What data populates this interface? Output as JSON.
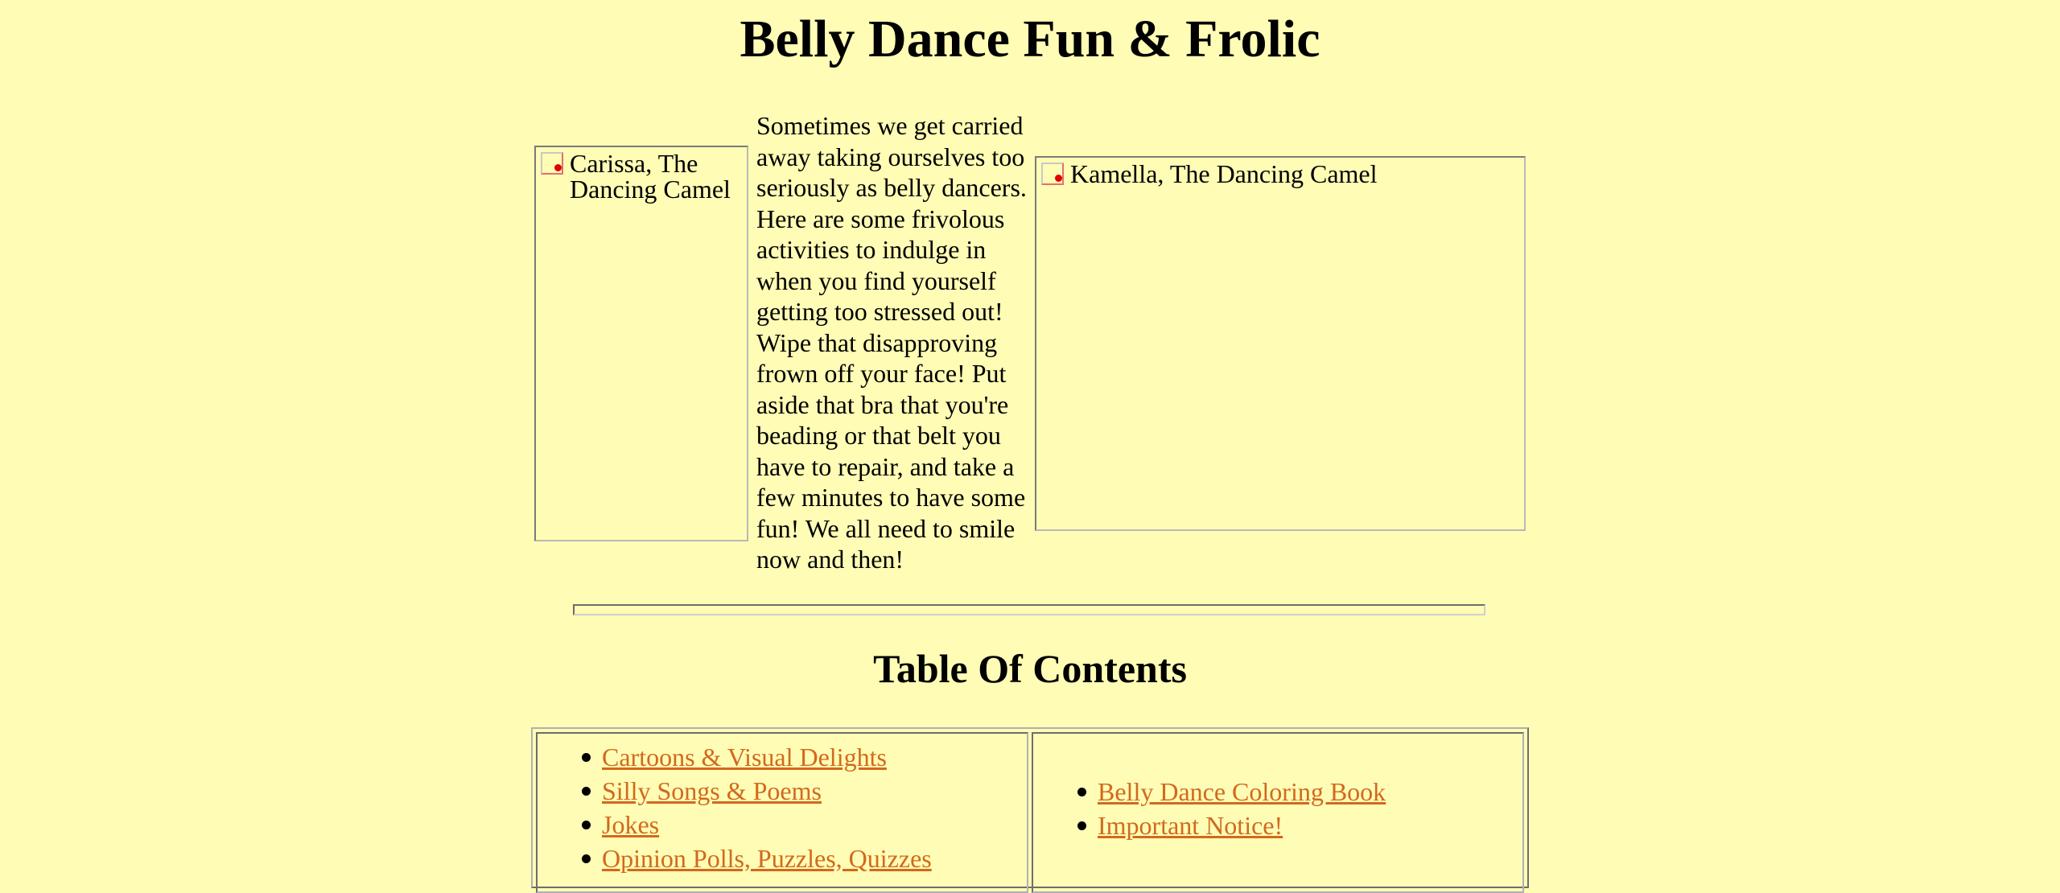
{
  "page": {
    "title": "Belly Dance Fun & Frolic"
  },
  "images": {
    "left": {
      "alt": "Carissa, The Dancing Camel",
      "icon": "broken-image-icon"
    },
    "right": {
      "alt": "Kamella, The Dancing Camel",
      "icon": "broken-image-icon"
    }
  },
  "intro": {
    "text": "Sometimes we get carried away taking ourselves too seriously as belly dancers. Here are some frivolous activities to indulge in when you find yourself getting too stressed out! Wipe that disapproving frown off your face! Put aside that bra that you're beading or that belt you have to repair, and take a few minutes to have some fun! We all need to smile now and then!"
  },
  "toc": {
    "heading": "Table Of Contents",
    "left_links": [
      "Cartoons & Visual Delights",
      "Silly Songs & Poems",
      "Jokes",
      "Opinion Polls, Puzzles, Quizzes"
    ],
    "right_links": [
      "Belly Dance Coloring Book",
      "Important Notice!"
    ]
  },
  "colors": {
    "background": "#fffcb5",
    "link": "#d2691e",
    "broken_image_dot": "#e20000"
  }
}
